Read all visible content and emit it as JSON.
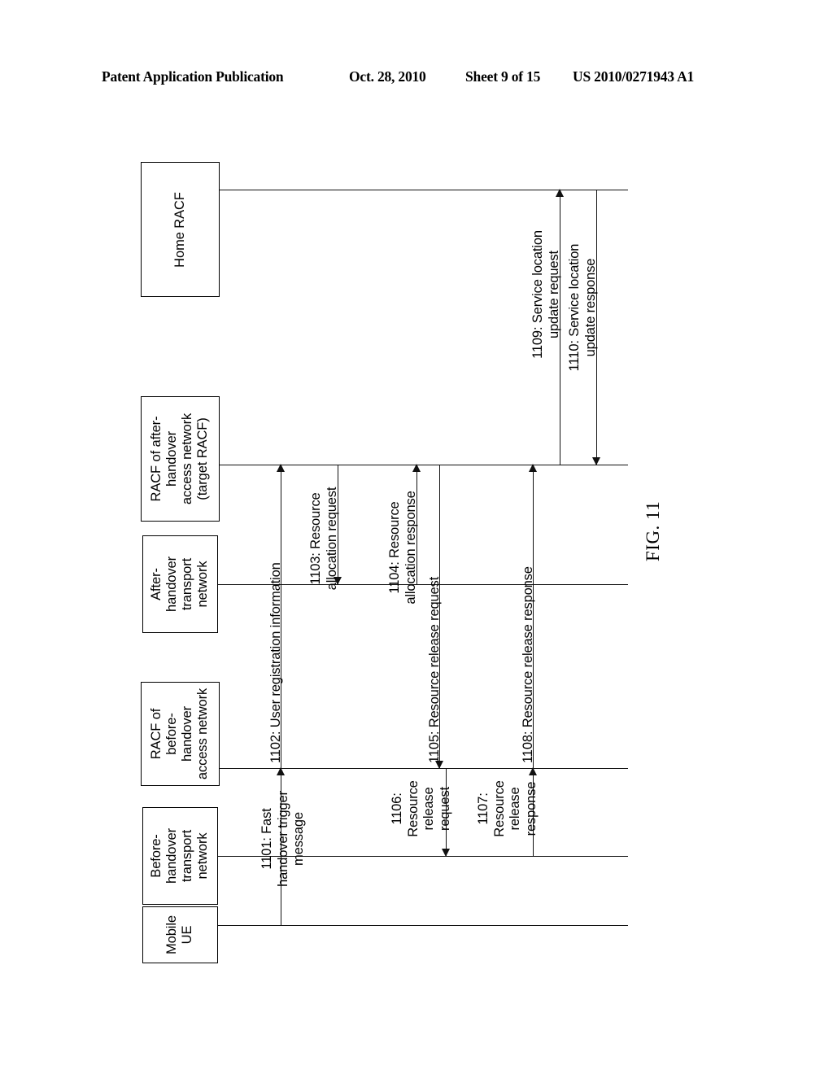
{
  "header": {
    "publication": "Patent Application Publication",
    "date": "Oct. 28, 2010",
    "sheet": "Sheet 9 of 15",
    "patent_number": "US 2010/0271943 A1"
  },
  "figure": {
    "number": "FIG. 11",
    "type": "sequence-diagram",
    "orientation": "rotated-90-ccw"
  },
  "actors": [
    {
      "id": "home-racf",
      "label": "Home RACF"
    },
    {
      "id": "target-racf",
      "label": "RACF of after-\nhandover\naccess network\n(target RACF)"
    },
    {
      "id": "after-transport",
      "label": "After-\nhandover\ntransport\nnetwork"
    },
    {
      "id": "before-racf",
      "label": "RACF of\nbefore-\nhandover\naccess network"
    },
    {
      "id": "before-transport",
      "label": "Before-\nhandover\ntransport\nnetwork"
    },
    {
      "id": "mobile-ue",
      "label": "Mobile\nUE"
    }
  ],
  "messages": [
    {
      "id": "1101",
      "label": "1101: Fast\nhandover trigger\nmessage",
      "from": "mobile-ue",
      "to": "before-racf",
      "direction": "up"
    },
    {
      "id": "1102",
      "label": "1102: User registration information",
      "from": "before-racf",
      "to": "target-racf",
      "direction": "up"
    },
    {
      "id": "1103",
      "label": "1103: Resource\nallocation request",
      "from": "target-racf",
      "to": "after-transport",
      "direction": "down"
    },
    {
      "id": "1104",
      "label": "1104: Resource\nallocation response",
      "from": "after-transport",
      "to": "target-racf",
      "direction": "up"
    },
    {
      "id": "1105",
      "label": "1105: Resource release request",
      "from": "target-racf",
      "to": "before-racf",
      "direction": "down"
    },
    {
      "id": "1106",
      "label": "1106:\nResource\nrelease\nrequest",
      "from": "before-racf",
      "to": "before-transport",
      "direction": "down"
    },
    {
      "id": "1107",
      "label": "1107:\nResource\nrelease\nresponse",
      "from": "before-transport",
      "to": "before-racf",
      "direction": "up"
    },
    {
      "id": "1108",
      "label": "1108: Resource release response",
      "from": "before-racf",
      "to": "target-racf",
      "direction": "up"
    },
    {
      "id": "1109",
      "label": "1109: Service location\nupdate request",
      "from": "target-racf",
      "to": "home-racf",
      "direction": "up"
    },
    {
      "id": "1110",
      "label": "1110: Service location\nupdate response",
      "from": "home-racf",
      "to": "target-racf",
      "direction": "down"
    }
  ],
  "colors": {
    "ink": "#000000",
    "paper": "#ffffff"
  }
}
